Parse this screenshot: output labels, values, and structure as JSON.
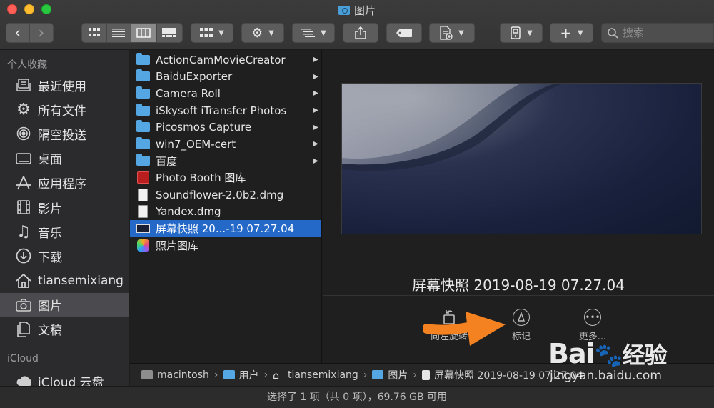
{
  "window": {
    "title": "图片"
  },
  "toolbar": {
    "back": "‹",
    "forward": "›",
    "search_placeholder": "搜索"
  },
  "sidebar": {
    "favorites_header": "个人收藏",
    "items": [
      {
        "label": "最近使用",
        "icon": "recents-icon"
      },
      {
        "label": "所有文件",
        "icon": "gear-icon"
      },
      {
        "label": "隔空投送",
        "icon": "airdrop-icon"
      },
      {
        "label": "桌面",
        "icon": "desktop-icon"
      },
      {
        "label": "应用程序",
        "icon": "applications-icon"
      },
      {
        "label": "影片",
        "icon": "movies-icon"
      },
      {
        "label": "音乐",
        "icon": "music-icon"
      },
      {
        "label": "下载",
        "icon": "downloads-icon"
      },
      {
        "label": "tiansemixiang",
        "icon": "home-icon"
      },
      {
        "label": "图片",
        "icon": "camera-icon",
        "selected": true
      },
      {
        "label": "文稿",
        "icon": "documents-icon"
      }
    ],
    "icloud_header": "iCloud",
    "icloud_items": [
      {
        "label": "iCloud 云盘",
        "icon": "cloud-icon"
      }
    ]
  },
  "column": {
    "items": [
      {
        "name": "ActionCamMovieCreator",
        "kind": "folder",
        "has_children": true
      },
      {
        "name": "BaiduExporter",
        "kind": "folder",
        "has_children": true
      },
      {
        "name": "Camera Roll",
        "kind": "folder",
        "has_children": true
      },
      {
        "name": "iSkysoft iTransfer Photos",
        "kind": "folder",
        "has_children": true
      },
      {
        "name": "Picosmos Capture",
        "kind": "folder",
        "has_children": true
      },
      {
        "name": "win7_OEM-cert",
        "kind": "folder",
        "has_children": true
      },
      {
        "name": "百度",
        "kind": "folder",
        "has_children": true
      },
      {
        "name": "Photo Booth 图库",
        "kind": "photobooth",
        "has_children": false
      },
      {
        "name": "Soundflower-2.0b2.dmg",
        "kind": "doc",
        "has_children": false
      },
      {
        "name": "Yandex.dmg",
        "kind": "doc",
        "has_children": false
      },
      {
        "name": "屏幕快照 20...-19 07.27.04",
        "kind": "screenshot",
        "has_children": false,
        "selected": true
      },
      {
        "name": "照片图库",
        "kind": "photos",
        "has_children": false
      }
    ]
  },
  "preview": {
    "filename": "屏幕快照 2019-08-19 07.27.04",
    "actions": [
      {
        "label": "向左旋转",
        "icon": "rotate-left-icon"
      },
      {
        "label": "标记",
        "icon": "markup-icon"
      },
      {
        "label": "更多...",
        "icon": "more-icon"
      }
    ]
  },
  "pathbar": {
    "segments": [
      {
        "label": "macintosh",
        "icon": "disk-icon"
      },
      {
        "label": "用户",
        "icon": "folder-icon"
      },
      {
        "label": "tiansemixiang",
        "icon": "home-icon"
      },
      {
        "label": "图片",
        "icon": "folder-icon"
      },
      {
        "label": "屏幕快照 2019-08-19 07.27.04",
        "icon": "file-icon"
      }
    ]
  },
  "status": {
    "text": "选择了 1 项（共 0 项），69.76 GB 可用"
  },
  "watermark": {
    "logo": "Bai",
    "logo_end": "经验",
    "url": "jingyan.baidu.com"
  },
  "colors": {
    "selection": "#2468c8",
    "folder": "#54a7e2",
    "annotation_arrow": "#f58220"
  }
}
